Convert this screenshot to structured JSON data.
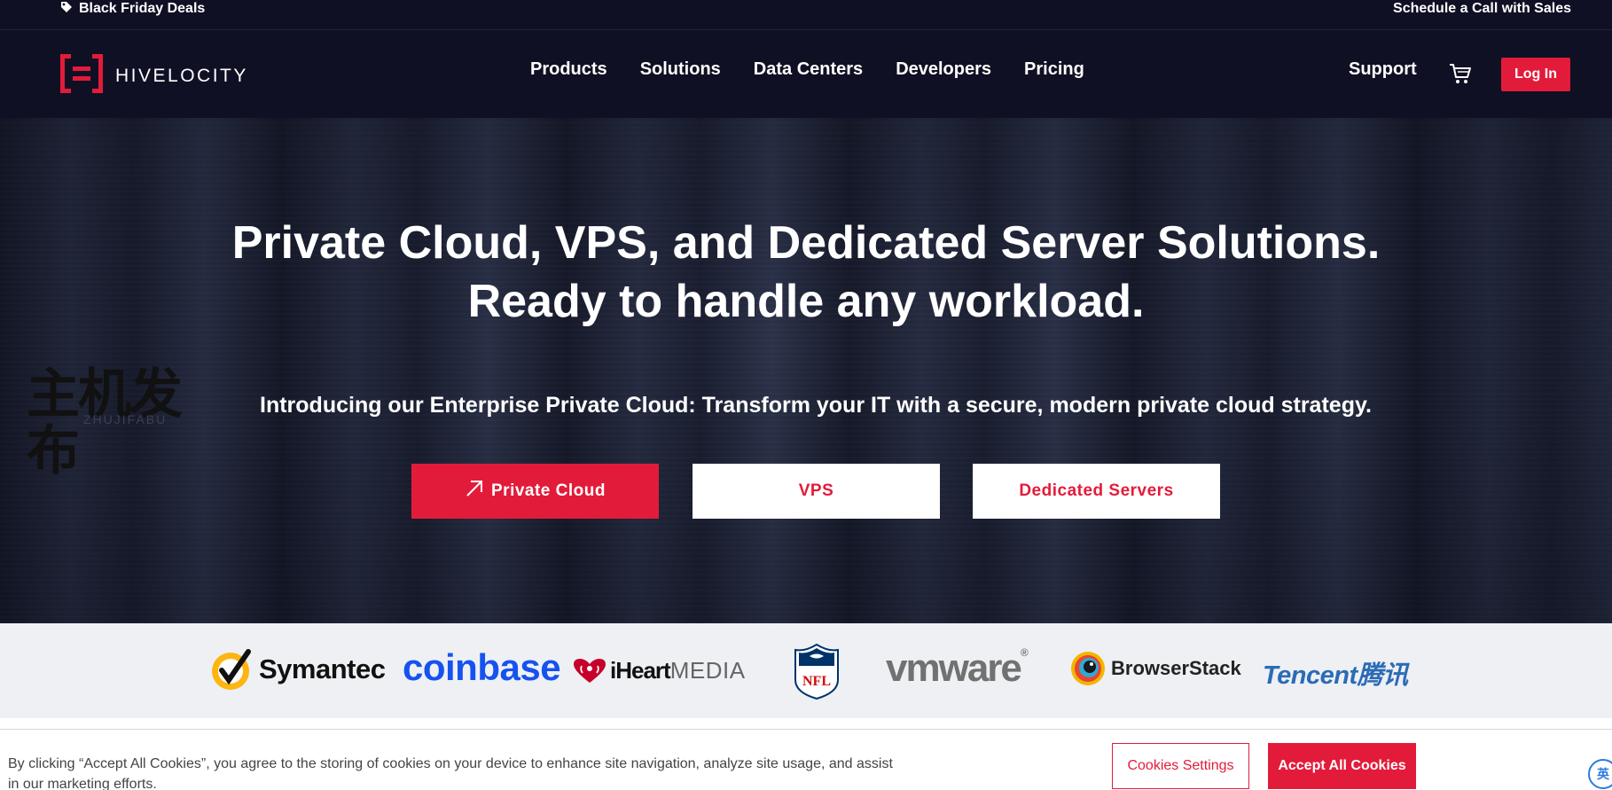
{
  "topbar": {
    "deals_label": "Black Friday Deals",
    "sales_label": "Schedule a Call with Sales",
    "tag_icon": "tag-icon"
  },
  "nav": {
    "logo_text": "HIVELOCITY",
    "links": [
      "Products",
      "Solutions",
      "Data Centers",
      "Developers",
      "Pricing"
    ],
    "support_label": "Support",
    "cart_icon": "cart-icon",
    "login_label": "Log In"
  },
  "hero": {
    "title_line1": "Private Cloud, VPS, and Dedicated Server Solutions.",
    "title_line2": "Ready to handle any workload.",
    "subtitle": "Introducing our Enterprise Private Cloud: Transform your IT with a secure, modern private cloud strategy.",
    "buttons": {
      "private_cloud": "Private Cloud",
      "vps": "VPS",
      "dedicated": "Dedicated Servers"
    },
    "arrow_icon": "arrow-up-right-icon"
  },
  "watermark": {
    "cn": "主机发布",
    "en": "ZHUJIFABU"
  },
  "logos": {
    "symantec": "Symantec",
    "coinbase": "coinbase",
    "iheart": "iHeart",
    "iheart_media": "MEDIA",
    "nfl": "NFL",
    "vmware": "vmware",
    "vmware_mark": "®",
    "browserstack": "BrowserStack",
    "tencent": "Tencent腾讯"
  },
  "cookie": {
    "text": "By clicking “Accept All Cookies”, you agree to the storing of cookies on your device to enhance site navigation, analyze site usage, and assist in our marketing efforts.",
    "settings_label": "Cookies Settings",
    "accept_label": "Accept All Cookies",
    "lang_badge": "英"
  },
  "colors": {
    "brand_red": "#e31b3a",
    "nav_bg": "#0f1024",
    "coinbase_blue": "#1652f0",
    "tencent_blue": "#2c6bb5"
  }
}
